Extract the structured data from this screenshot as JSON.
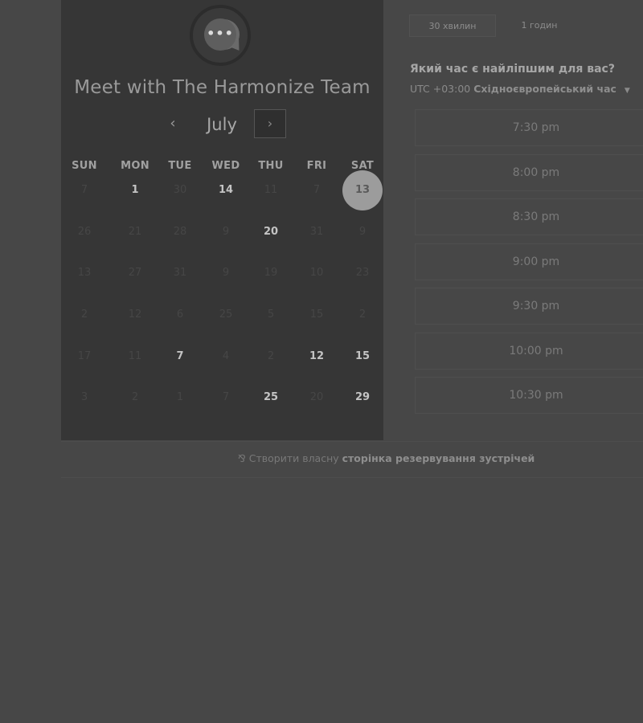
{
  "header": {
    "title": "Meet with The Harmonize Team",
    "avatar_icon": "chat-bubble-icon",
    "avatar_glyph": "•••"
  },
  "calendar": {
    "month": "July",
    "prev_glyph": "‹",
    "next_glyph": "›",
    "weekdays": [
      "SUN",
      "MON",
      "TUE",
      "WED",
      "THU",
      "FRI",
      "SAT"
    ],
    "weeks": [
      [
        {
          "d": "7",
          "s": "off"
        },
        {
          "d": "1",
          "s": "avail"
        },
        {
          "d": "30",
          "s": "off"
        },
        {
          "d": "14",
          "s": "avail"
        },
        {
          "d": "11",
          "s": "off"
        },
        {
          "d": "7",
          "s": "off"
        },
        {
          "d": "13",
          "s": "selected"
        }
      ],
      [
        {
          "d": "26",
          "s": "off"
        },
        {
          "d": "21",
          "s": "off"
        },
        {
          "d": "28",
          "s": "off"
        },
        {
          "d": "9",
          "s": "off"
        },
        {
          "d": "20",
          "s": "avail"
        },
        {
          "d": "31",
          "s": "off"
        },
        {
          "d": "9",
          "s": "off"
        }
      ],
      [
        {
          "d": "13",
          "s": "off"
        },
        {
          "d": "27",
          "s": "off"
        },
        {
          "d": "31",
          "s": "off"
        },
        {
          "d": "9",
          "s": "off"
        },
        {
          "d": "19",
          "s": "off"
        },
        {
          "d": "10",
          "s": "off"
        },
        {
          "d": "23",
          "s": "off"
        }
      ],
      [
        {
          "d": "2",
          "s": "off"
        },
        {
          "d": "12",
          "s": "off"
        },
        {
          "d": "6",
          "s": "off"
        },
        {
          "d": "25",
          "s": "off"
        },
        {
          "d": "5",
          "s": "off"
        },
        {
          "d": "15",
          "s": "off"
        },
        {
          "d": "2",
          "s": "off"
        }
      ],
      [
        {
          "d": "17",
          "s": "off"
        },
        {
          "d": "11",
          "s": "off"
        },
        {
          "d": "7",
          "s": "avail"
        },
        {
          "d": "4",
          "s": "off"
        },
        {
          "d": "2",
          "s": "off"
        },
        {
          "d": "12",
          "s": "avail"
        },
        {
          "d": "15",
          "s": "avail"
        }
      ],
      [
        {
          "d": "3",
          "s": "off"
        },
        {
          "d": "2",
          "s": "off"
        },
        {
          "d": "1",
          "s": "off"
        },
        {
          "d": "7",
          "s": "off"
        },
        {
          "d": "25",
          "s": "avail"
        },
        {
          "d": "20",
          "s": "off"
        },
        {
          "d": "29",
          "s": "avail"
        }
      ]
    ]
  },
  "duration_tabs": [
    {
      "label": "30 хвилин",
      "active": true
    },
    {
      "label": "1 годин",
      "active": false
    }
  ],
  "time_prompt": "Який час є найліпшим для вас?",
  "timezone": {
    "offset": "UTC +03:00",
    "name": "Східноєвропейський час",
    "caret": "▼"
  },
  "time_slots": [
    "7:30 pm",
    "8:00 pm",
    "8:30 pm",
    "9:00 pm",
    "9:30 pm",
    "10:00 pm",
    "10:30 pm"
  ],
  "footer": {
    "icon": "sprocket-icon",
    "icon_glyph": "⅋",
    "text_plain": "Створити власну",
    "text_bold": "сторінка резервування зустрічей"
  }
}
